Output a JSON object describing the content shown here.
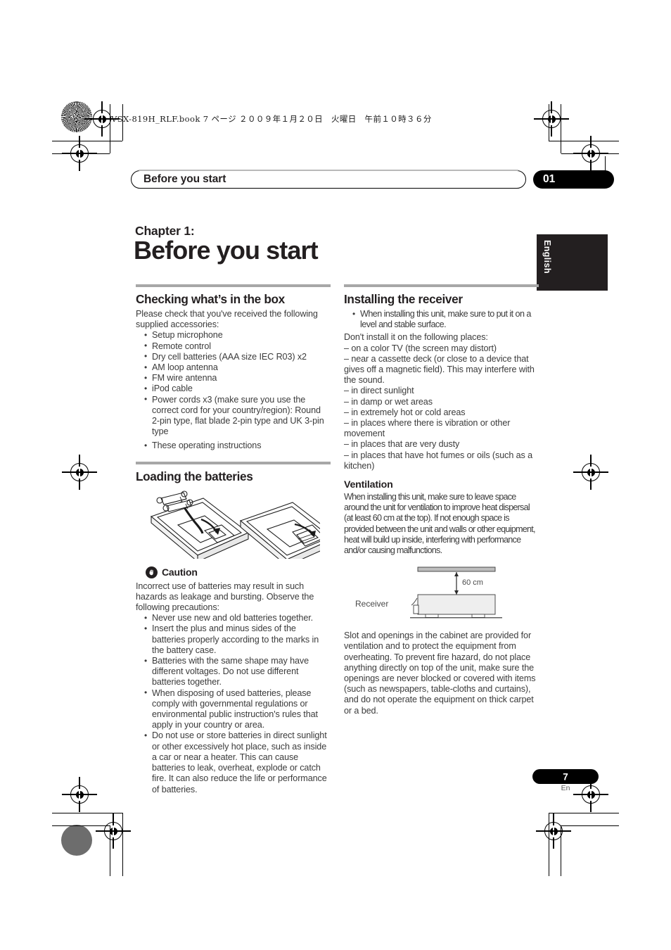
{
  "print_header": {
    "file_line": "VSX-819H_RLF.book  7 ページ  ２００９年１月２０日　火曜日　午前１０時３６分"
  },
  "running_header": {
    "title": "Before you start",
    "chapter_number": "01"
  },
  "side_tab": {
    "language": "English"
  },
  "chapter": {
    "label": "Chapter 1:",
    "title": "Before you start"
  },
  "left_column": {
    "section_box": {
      "heading": "Checking what’s in the box",
      "intro": "Please check that you've received the following supplied accessories:",
      "items": [
        "Setup microphone",
        "Remote control",
        "Dry cell batteries (AAA size IEC R03) x2",
        "AM loop antenna",
        "FM wire antenna",
        "iPod cable",
        "Power cords x3 (make sure you use the correct cord for your country/region): Round 2-pin type, flat blade 2-pin type and UK 3-pin type",
        "These operating instructions"
      ]
    },
    "section_batteries": {
      "heading": "Loading the batteries",
      "figure_name": "remote-control-battery-loading-illustration",
      "caution_label": "Caution",
      "caution_intro": "Incorrect use of batteries may result in such hazards as leakage and bursting. Observe the following precautions:",
      "caution_items": [
        "Never use new and old batteries together.",
        "Insert the plus and minus sides of the batteries properly according to the marks in the battery case.",
        "Batteries with the same shape may have different voltages. Do not use different batteries together.",
        "When disposing of used batteries, please comply with governmental regulations or environmental public instruction's rules that apply in your country or area.",
        "Do not use or store batteries in direct sunlight or other excessively hot place, such as inside a car or near a heater. This can cause batteries to leak, overheat, explode or catch fire. It can also reduce the life or performance of batteries."
      ]
    }
  },
  "right_column": {
    "section_install": {
      "heading": "Installing the receiver",
      "bullets": [
        "When installing this unit, make sure to put it on a level and stable surface."
      ],
      "dont_intro": "Don't install it on the following places:",
      "dont_items": [
        "on a color TV (the screen may distort)",
        "near a cassette deck (or close to a device that gives off a magnetic field). This may interfere with the sound.",
        "in direct sunlight",
        "in damp or wet areas",
        "in extremely hot or cold areas",
        "in places where there is vibration or other movement",
        "in places that are very dusty",
        "in places that have hot fumes or oils (such as a kitchen)"
      ]
    },
    "section_ventilation": {
      "heading": "Ventilation",
      "paragraph": "When installing this unit, make sure to leave space around the unit for ventilation to improve heat dispersal (at least 60 cm at the top). If not enough space is provided between the unit and walls or other equipment, heat will build up inside, interfering with performance and/or causing malfunctions.",
      "diagram": {
        "clearance_label": "60 cm",
        "receiver_label": "Receiver"
      },
      "closing_paragraph": "Slot and openings in the cabinet are provided for ventilation and to protect the equipment from overheating. To prevent fire hazard, do not place anything directly on top of the unit, make sure the openings are never blocked or covered with items (such as newspapers, table-cloths and curtains), and do not operate the equipment on thick carpet or a bed."
    }
  },
  "footer": {
    "page_number": "7",
    "page_language": "En"
  },
  "colors": {
    "ink": "#231f20",
    "body_text": "#3b3b3b",
    "rule": "#a7a7a7",
    "tab_black": "#231f20"
  }
}
